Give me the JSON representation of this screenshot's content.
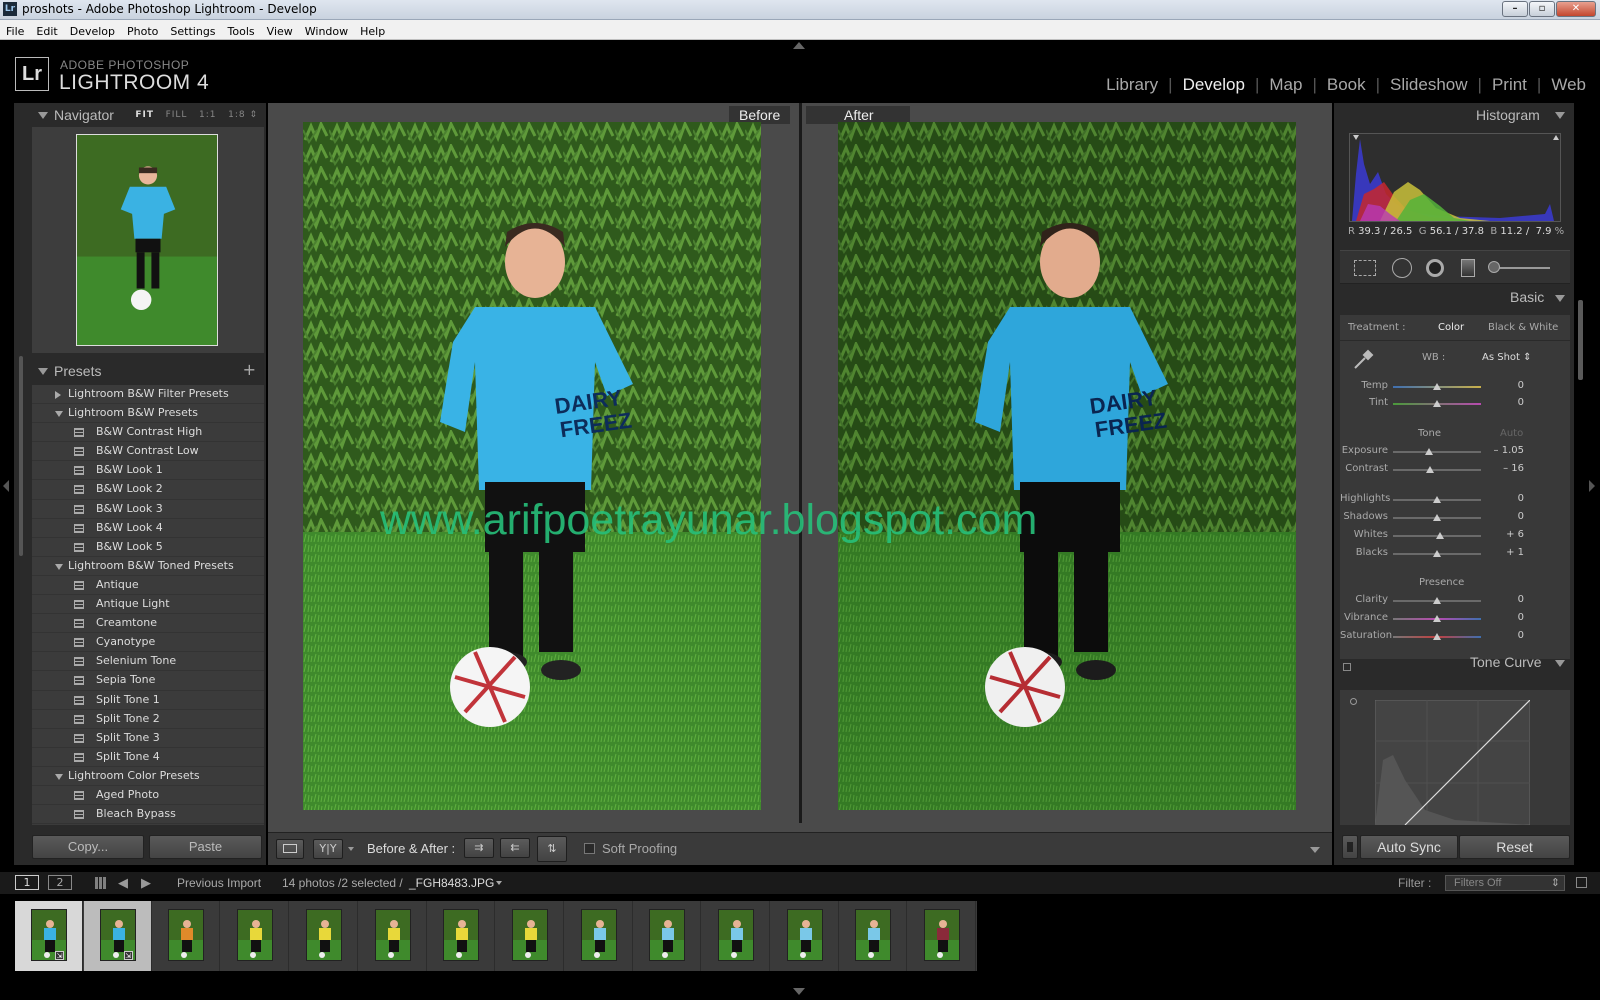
{
  "window": {
    "title": "proshots - Adobe Photoshop Lightroom - Develop",
    "app_icon": "Lr"
  },
  "menu": [
    "File",
    "Edit",
    "Develop",
    "Photo",
    "Settings",
    "Tools",
    "View",
    "Window",
    "Help"
  ],
  "identity": {
    "badge": "Lr",
    "line1": "ADOBE PHOTOSHOP",
    "line2": "LIGHTROOM 4"
  },
  "modules": {
    "items": [
      "Library",
      "Develop",
      "Map",
      "Book",
      "Slideshow",
      "Print",
      "Web"
    ],
    "active": "Develop"
  },
  "navigator": {
    "title": "Navigator",
    "fit": "FIT",
    "fill": "FILL",
    "one": "1:1",
    "ratio": "1:8"
  },
  "presets": {
    "title": "Presets",
    "add": "+",
    "rows": [
      {
        "type": "folder",
        "open": false,
        "label": "Lightroom B&W Filter Presets"
      },
      {
        "type": "folder",
        "open": true,
        "label": "Lightroom B&W Presets"
      },
      {
        "type": "item",
        "label": "B&W Contrast High"
      },
      {
        "type": "item",
        "label": "B&W Contrast Low"
      },
      {
        "type": "item",
        "label": "B&W Look 1"
      },
      {
        "type": "item",
        "label": "B&W Look 2"
      },
      {
        "type": "item",
        "label": "B&W Look 3"
      },
      {
        "type": "item",
        "label": "B&W Look 4"
      },
      {
        "type": "item",
        "label": "B&W Look 5"
      },
      {
        "type": "folder",
        "open": true,
        "label": "Lightroom B&W Toned Presets"
      },
      {
        "type": "item",
        "label": "Antique"
      },
      {
        "type": "item",
        "label": "Antique Light"
      },
      {
        "type": "item",
        "label": "Creamtone"
      },
      {
        "type": "item",
        "label": "Cyanotype"
      },
      {
        "type": "item",
        "label": "Selenium Tone"
      },
      {
        "type": "item",
        "label": "Sepia Tone"
      },
      {
        "type": "item",
        "label": "Split Tone 1"
      },
      {
        "type": "item",
        "label": "Split Tone 2"
      },
      {
        "type": "item",
        "label": "Split Tone 3"
      },
      {
        "type": "item",
        "label": "Split Tone 4"
      },
      {
        "type": "folder",
        "open": true,
        "label": "Lightroom Color Presets"
      },
      {
        "type": "item",
        "label": "Aged Photo"
      },
      {
        "type": "item",
        "label": "Bleach Bypass"
      }
    ]
  },
  "left_buttons": {
    "copy": "Copy...",
    "paste": "Paste"
  },
  "view": {
    "before": "Before",
    "after": "After",
    "watermark": "www.arifpoetrayunar.blogspot.com"
  },
  "toolbar": {
    "yy": "Y|Y",
    "before_after": "Before & After :",
    "soft_proofing": "Soft Proofing"
  },
  "histogram": {
    "title": "Histogram",
    "r_label": "R",
    "r": "39.3 / 26.5",
    "g_label": "G",
    "g": "56.1 / 37.8",
    "b_label": "B",
    "b": "11.2 /",
    "b2": "7.9",
    "pct": "%"
  },
  "basic": {
    "title": "Basic",
    "treatment_label": "Treatment :",
    "treatment_color": "Color",
    "treatment_bw": "Black & White",
    "wb_label": "WB :",
    "wb_value": "As Shot",
    "tone_label": "Tone",
    "auto": "Auto",
    "presence_label": "Presence",
    "sliders": [
      {
        "name": "Temp",
        "value": "0",
        "pos": 0.5,
        "group": "wb"
      },
      {
        "name": "Tint",
        "value": "0",
        "pos": 0.5,
        "group": "wb"
      },
      {
        "name": "Exposure",
        "value": "– 1.05",
        "pos": 0.41,
        "group": "tone"
      },
      {
        "name": "Contrast",
        "value": "– 16",
        "pos": 0.42,
        "group": "tone"
      },
      {
        "name": "Highlights",
        "value": "0",
        "pos": 0.5,
        "group": "tone2"
      },
      {
        "name": "Shadows",
        "value": "0",
        "pos": 0.5,
        "group": "tone2"
      },
      {
        "name": "Whites",
        "value": "+ 6",
        "pos": 0.53,
        "group": "tone2"
      },
      {
        "name": "Blacks",
        "value": "+ 1",
        "pos": 0.505,
        "group": "tone2"
      },
      {
        "name": "Clarity",
        "value": "0",
        "pos": 0.5,
        "group": "presence"
      },
      {
        "name": "Vibrance",
        "value": "0",
        "pos": 0.5,
        "group": "presence"
      },
      {
        "name": "Saturation",
        "value": "0",
        "pos": 0.5,
        "group": "presence"
      }
    ]
  },
  "tone_curve": {
    "title": "Tone Curve"
  },
  "right_buttons": {
    "auto_sync": "Auto Sync",
    "reset": "Reset"
  },
  "filmstrip_bar": {
    "screen1": "1",
    "screen2": "2",
    "source": "Previous Import",
    "count": "14 photos /2 selected /",
    "filename": "_FGH8483.JPG",
    "filter_label": "Filter :",
    "filter_value": "Filters Off"
  },
  "filmstrip": {
    "count": 14,
    "selected": [
      0,
      1
    ]
  }
}
